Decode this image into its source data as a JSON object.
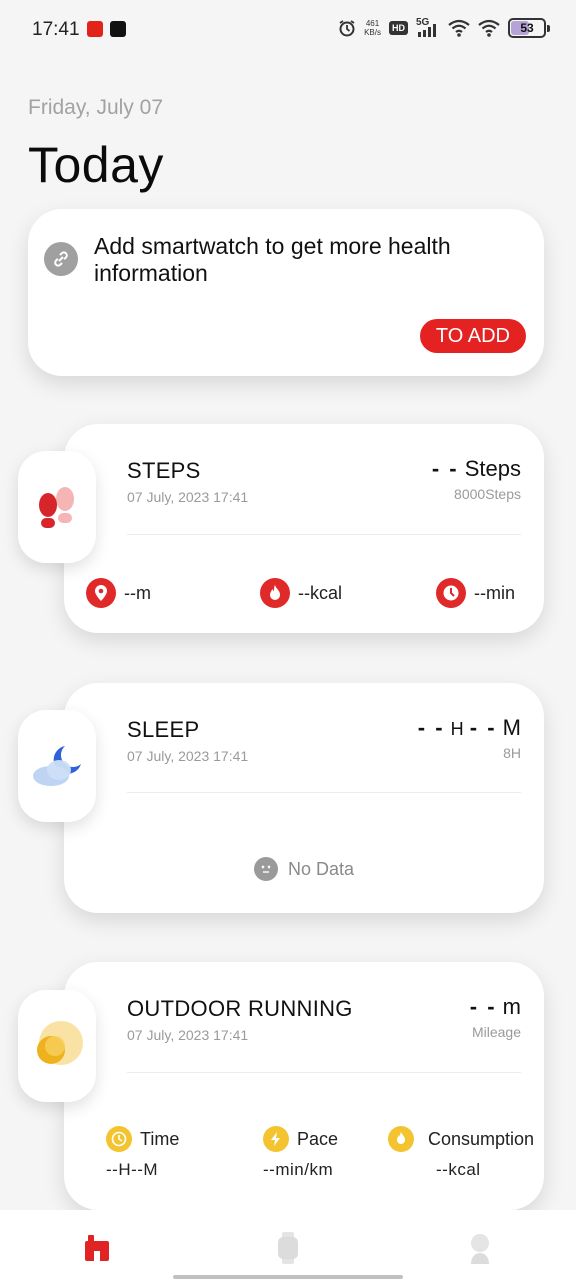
{
  "status_bar": {
    "time": "17:41",
    "net_speed_value": "461",
    "net_speed_unit": "KB/s",
    "hd": "HD",
    "network": "5G",
    "battery": "53",
    "battery_level": 0.53
  },
  "header": {
    "date": "Friday, July 07",
    "title": "Today"
  },
  "add_device": {
    "text": "Add smartwatch to get more health information",
    "button": "TO ADD"
  },
  "steps": {
    "title": "STEPS",
    "time": "07 July, 2023 17:41",
    "value": "- -",
    "unit": "Steps",
    "goal": "8000Steps",
    "distance": "--m",
    "calories": "--kcal",
    "duration": "--min"
  },
  "sleep": {
    "title": "SLEEP",
    "time": "07 July, 2023 17:41",
    "hours": "- -",
    "hours_unit": "H",
    "minutes": "- -",
    "minutes_unit": "M",
    "goal": "8H",
    "no_data": "No Data"
  },
  "running": {
    "title": "OUTDOOR RUNNING",
    "time": "07 July, 2023 17:41",
    "value": "- -",
    "unit": "m",
    "sub": "Mileage",
    "time_label": "Time",
    "time_value": "--H--M",
    "pace_label": "Pace",
    "pace_value": "--min/km",
    "consumption_label": "Consumption",
    "consumption_value": "--kcal"
  },
  "colors": {
    "accent": "#e52222",
    "yellow": "#f4c430"
  },
  "nav": [
    "home-icon",
    "watch-icon",
    "profile-icon"
  ]
}
